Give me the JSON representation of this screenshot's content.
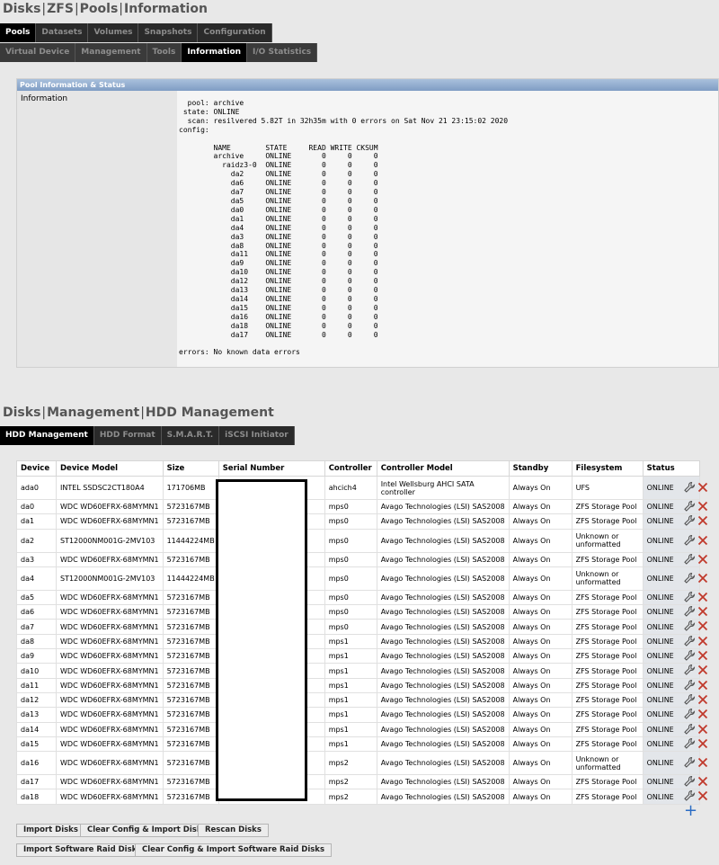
{
  "breadcrumb1": {
    "items": [
      "Disks",
      "ZFS",
      "Pools",
      "Information"
    ]
  },
  "tabs_row1": [
    "Pools",
    "Datasets",
    "Volumes",
    "Snapshots",
    "Configuration"
  ],
  "tabs_row2": [
    "Virtual Device",
    "Management",
    "Tools",
    "Information",
    "I/O Statistics"
  ],
  "pane": {
    "title": "Pool Information & Status",
    "label": "Information",
    "output": "  pool: archive\n state: ONLINE\n  scan: resilvered 5.82T in 32h35m with 0 errors on Sat Nov 21 23:15:02 2020\nconfig:\n\n        NAME        STATE     READ WRITE CKSUM\n        archive     ONLINE       0     0     0\n          raidz3-0  ONLINE       0     0     0\n            da2     ONLINE       0     0     0\n            da6     ONLINE       0     0     0\n            da7     ONLINE       0     0     0\n            da5     ONLINE       0     0     0\n            da0     ONLINE       0     0     0\n            da1     ONLINE       0     0     0\n            da4     ONLINE       0     0     0\n            da3     ONLINE       0     0     0\n            da8     ONLINE       0     0     0\n            da11    ONLINE       0     0     0\n            da9     ONLINE       0     0     0\n            da10    ONLINE       0     0     0\n            da12    ONLINE       0     0     0\n            da13    ONLINE       0     0     0\n            da14    ONLINE       0     0     0\n            da15    ONLINE       0     0     0\n            da16    ONLINE       0     0     0\n            da18    ONLINE       0     0     0\n            da17    ONLINE       0     0     0\n\nerrors: No known data errors"
  },
  "breadcrumb2": {
    "items": [
      "Disks",
      "Management",
      "HDD Management"
    ]
  },
  "tabs_row3": [
    "HDD Management",
    "HDD Format",
    "S.M.A.R.T.",
    "iSCSI Initiator"
  ],
  "table": {
    "headers": [
      "Device",
      "Device Model",
      "Size",
      "Serial Number",
      "Controller",
      "Controller Model",
      "Standby",
      "Filesystem",
      "Status"
    ],
    "rows": [
      [
        "ada0",
        "INTEL SSDSC2CT180A4",
        "171706MB",
        "",
        "ahcich4",
        "Intel Wellsburg AHCI SATA controller",
        "Always On",
        "UFS",
        "ONLINE"
      ],
      [
        "da0",
        "WDC WD60EFRX-68MYMN1",
        "5723167MB",
        "",
        "mps0",
        "Avago Technologies (LSI) SAS2008",
        "Always On",
        "ZFS Storage Pool",
        "ONLINE"
      ],
      [
        "da1",
        "WDC WD60EFRX-68MYMN1",
        "5723167MB",
        "",
        "mps0",
        "Avago Technologies (LSI) SAS2008",
        "Always On",
        "ZFS Storage Pool",
        "ONLINE"
      ],
      [
        "da2",
        "ST12000NM001G-2MV103",
        "11444224MB",
        "",
        "mps0",
        "Avago Technologies (LSI) SAS2008",
        "Always On",
        "Unknown or unformatted",
        "ONLINE"
      ],
      [
        "da3",
        "WDC WD60EFRX-68MYMN1",
        "5723167MB",
        "",
        "mps0",
        "Avago Technologies (LSI) SAS2008",
        "Always On",
        "ZFS Storage Pool",
        "ONLINE"
      ],
      [
        "da4",
        "ST12000NM001G-2MV103",
        "11444224MB",
        "",
        "mps0",
        "Avago Technologies (LSI) SAS2008",
        "Always On",
        "Unknown or unformatted",
        "ONLINE"
      ],
      [
        "da5",
        "WDC WD60EFRX-68MYMN1",
        "5723167MB",
        "",
        "mps0",
        "Avago Technologies (LSI) SAS2008",
        "Always On",
        "ZFS Storage Pool",
        "ONLINE"
      ],
      [
        "da6",
        "WDC WD60EFRX-68MYMN1",
        "5723167MB",
        "",
        "mps0",
        "Avago Technologies (LSI) SAS2008",
        "Always On",
        "ZFS Storage Pool",
        "ONLINE"
      ],
      [
        "da7",
        "WDC WD60EFRX-68MYMN1",
        "5723167MB",
        "",
        "mps0",
        "Avago Technologies (LSI) SAS2008",
        "Always On",
        "ZFS Storage Pool",
        "ONLINE"
      ],
      [
        "da8",
        "WDC WD60EFRX-68MYMN1",
        "5723167MB",
        "",
        "mps1",
        "Avago Technologies (LSI) SAS2008",
        "Always On",
        "ZFS Storage Pool",
        "ONLINE"
      ],
      [
        "da9",
        "WDC WD60EFRX-68MYMN1",
        "5723167MB",
        "",
        "mps1",
        "Avago Technologies (LSI) SAS2008",
        "Always On",
        "ZFS Storage Pool",
        "ONLINE"
      ],
      [
        "da10",
        "WDC WD60EFRX-68MYMN1",
        "5723167MB",
        "",
        "mps1",
        "Avago Technologies (LSI) SAS2008",
        "Always On",
        "ZFS Storage Pool",
        "ONLINE"
      ],
      [
        "da11",
        "WDC WD60EFRX-68MYMN1",
        "5723167MB",
        "",
        "mps1",
        "Avago Technologies (LSI) SAS2008",
        "Always On",
        "ZFS Storage Pool",
        "ONLINE"
      ],
      [
        "da12",
        "WDC WD60EFRX-68MYMN1",
        "5723167MB",
        "",
        "mps1",
        "Avago Technologies (LSI) SAS2008",
        "Always On",
        "ZFS Storage Pool",
        "ONLINE"
      ],
      [
        "da13",
        "WDC WD60EFRX-68MYMN1",
        "5723167MB",
        "",
        "mps1",
        "Avago Technologies (LSI) SAS2008",
        "Always On",
        "ZFS Storage Pool",
        "ONLINE"
      ],
      [
        "da14",
        "WDC WD60EFRX-68MYMN1",
        "5723167MB",
        "",
        "mps1",
        "Avago Technologies (LSI) SAS2008",
        "Always On",
        "ZFS Storage Pool",
        "ONLINE"
      ],
      [
        "da15",
        "WDC WD60EFRX-68MYMN1",
        "5723167MB",
        "",
        "mps1",
        "Avago Technologies (LSI) SAS2008",
        "Always On",
        "ZFS Storage Pool",
        "ONLINE"
      ],
      [
        "da16",
        "WDC WD60EFRX-68MYMN1",
        "5723167MB",
        "",
        "mps2",
        "Avago Technologies (LSI) SAS2008",
        "Always On",
        "Unknown or unformatted",
        "ONLINE"
      ],
      [
        "da17",
        "WDC WD60EFRX-68MYMN1",
        "5723167MB",
        "",
        "mps2",
        "Avago Technologies (LSI) SAS2008",
        "Always On",
        "ZFS Storage Pool",
        "ONLINE"
      ],
      [
        "da18",
        "WDC WD60EFRX-68MYMN1",
        "5723167MB",
        "",
        "mps2",
        "Avago Technologies (LSI) SAS2008",
        "Always On",
        "ZFS Storage Pool",
        "ONLINE"
      ]
    ]
  },
  "icons": {
    "edit": "wrench-icon",
    "delete": "delete-x-icon",
    "add": "plus-icon"
  },
  "colors": {
    "delete": "#c0392b",
    "add": "#2b6cc4",
    "pane_header": "#8aa6cc"
  },
  "buttons": {
    "import_disks": "Import Disks",
    "clear_import": "Clear Config & Import Disks",
    "rescan": "Rescan Disks",
    "import_raid": "Import Software Raid Disks",
    "clear_import_raid": "Clear Config & Import Software Raid Disks"
  }
}
